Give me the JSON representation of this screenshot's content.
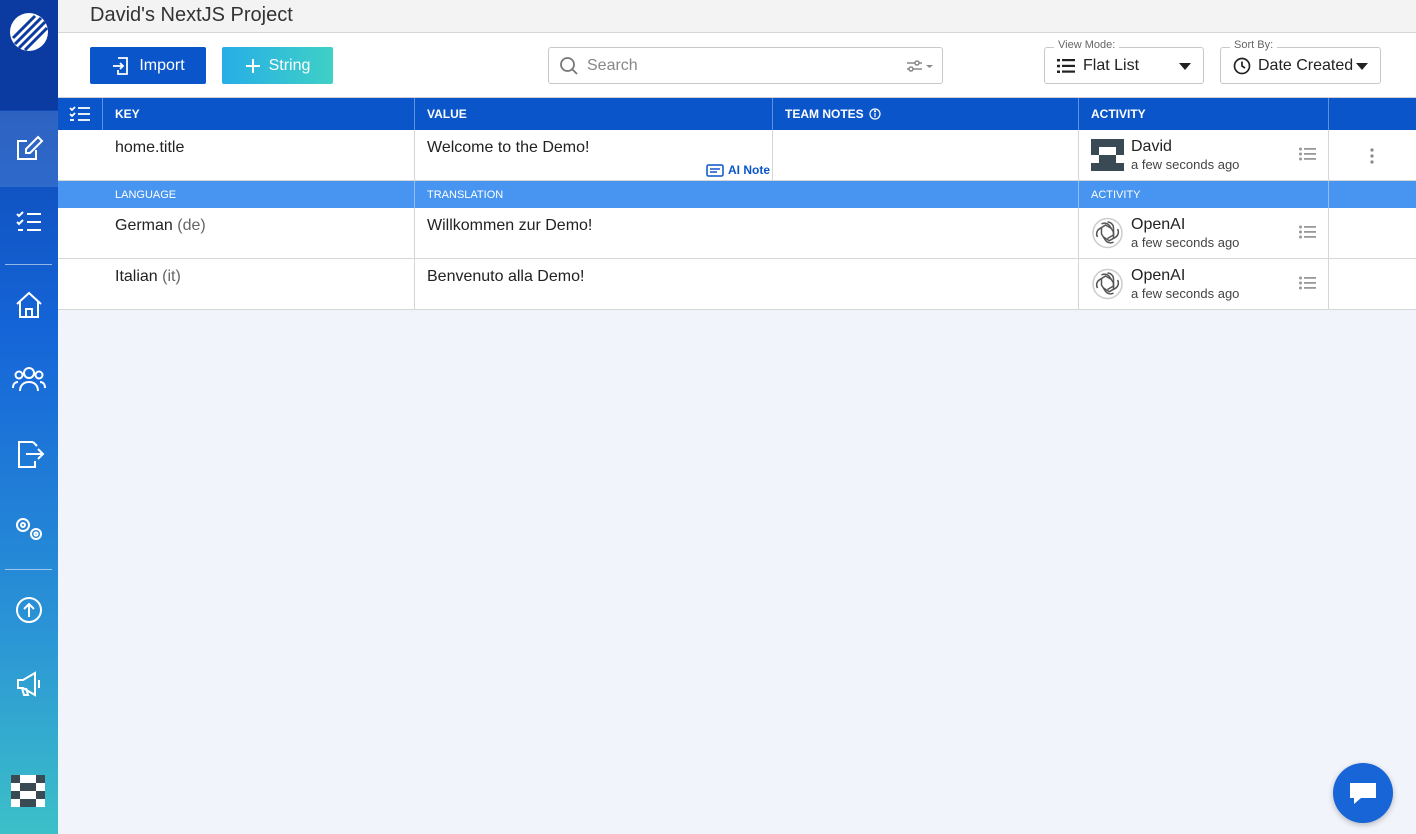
{
  "project": {
    "title": "David's NextJS Project"
  },
  "sidebar": {
    "items": [
      {
        "icon": "edit-icon",
        "active": true
      },
      {
        "icon": "checklist-icon"
      },
      {
        "icon": "home-icon"
      },
      {
        "icon": "users-icon"
      },
      {
        "icon": "export-icon"
      },
      {
        "icon": "settings-icon"
      },
      {
        "icon": "upload-icon"
      },
      {
        "icon": "megaphone-icon"
      }
    ]
  },
  "toolbar": {
    "import_label": "Import",
    "string_label": "String",
    "search_placeholder": "Search",
    "view_mode_legend": "View Mode:",
    "view_mode_value": "Flat List",
    "sort_legend": "Sort By:",
    "sort_value": "Date Created"
  },
  "table": {
    "headers": {
      "key": "KEY",
      "value": "VALUE",
      "team_notes": "TEAM NOTES",
      "activity": "ACTIVITY"
    },
    "string": {
      "key": "home.title",
      "value": "Welcome to the Demo!",
      "ai_note_label": "AI Note",
      "activity": {
        "user": "David",
        "time": "a few seconds ago"
      }
    },
    "sub_headers": {
      "language": "LANGUAGE",
      "translation": "TRANSLATION",
      "activity": "ACTIVITY"
    },
    "translations": [
      {
        "language": "German",
        "code": "(de)",
        "text": "Willkommen zur Demo!",
        "user": "OpenAI",
        "time": "a few seconds ago"
      },
      {
        "language": "Italian",
        "code": "(it)",
        "text": "Benvenuto alla Demo!",
        "user": "OpenAI",
        "time": "a few seconds ago"
      }
    ]
  },
  "colors": {
    "primary": "#0a55c9",
    "subheader": "#4795f0",
    "accent": "#3fd0c6"
  }
}
